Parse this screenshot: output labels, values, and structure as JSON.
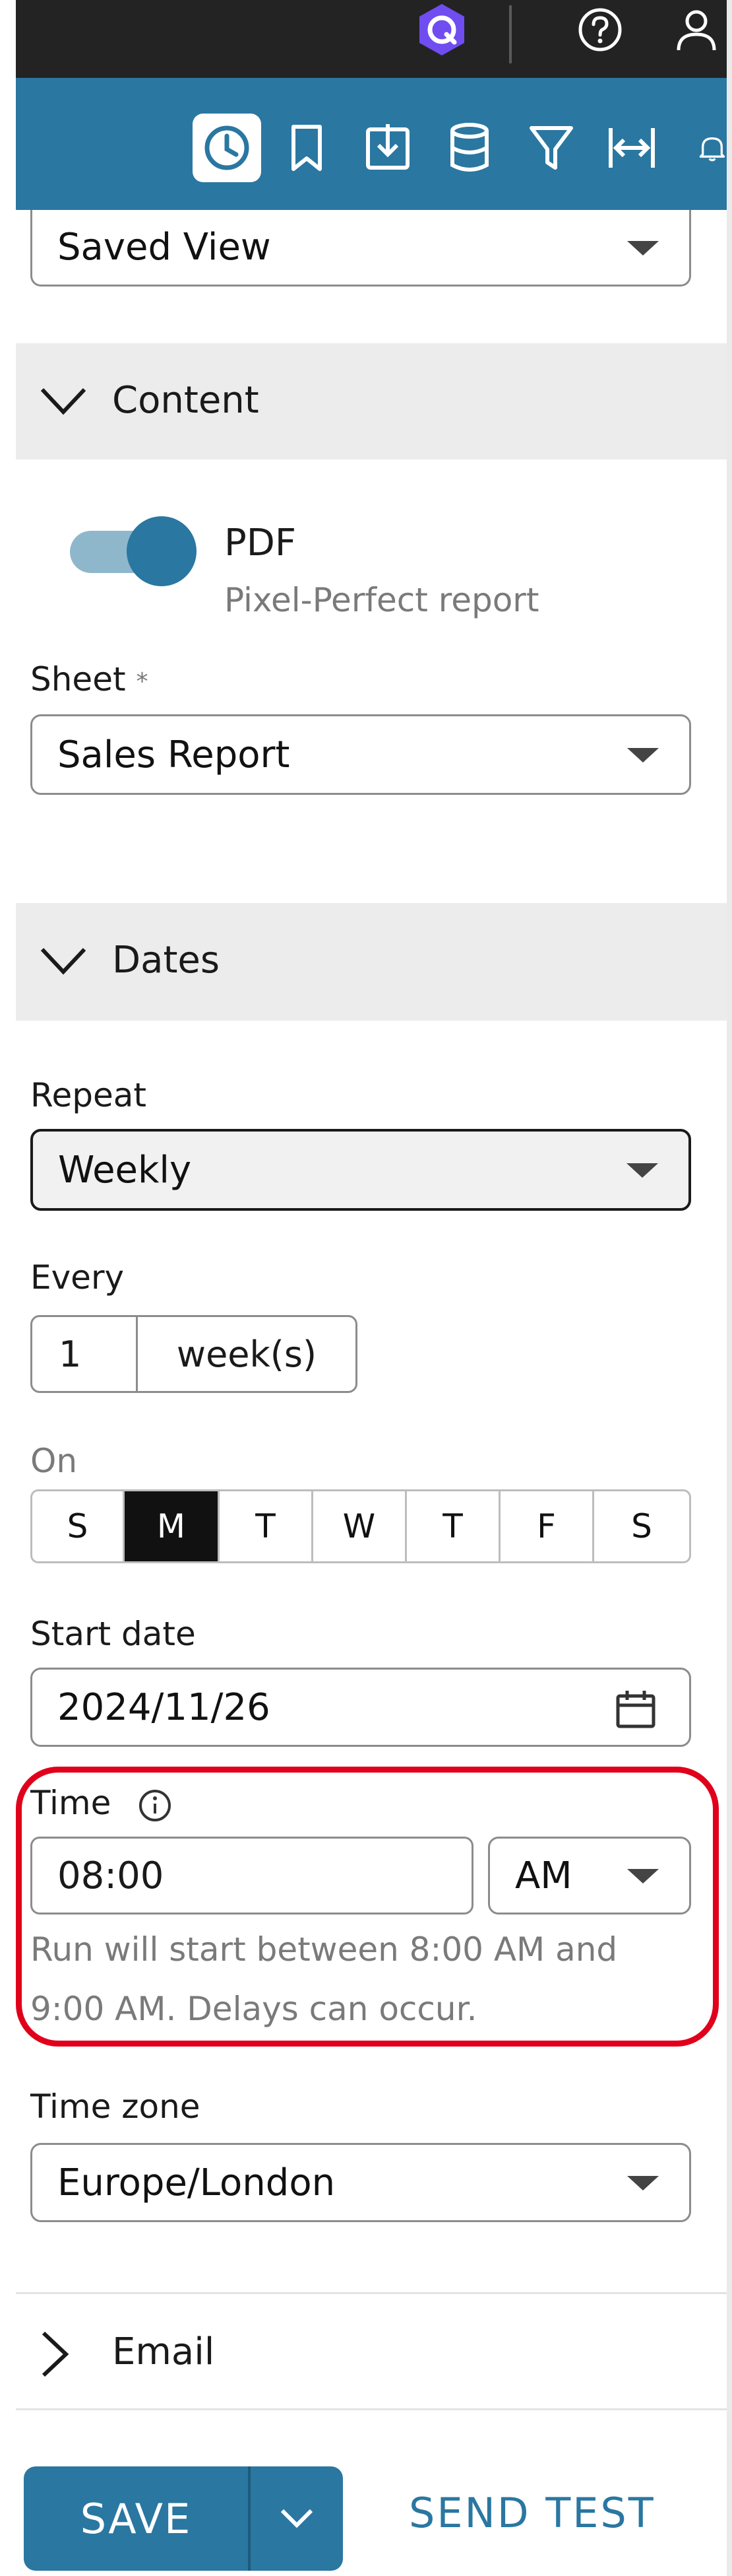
{
  "topbar": {
    "icons": [
      "app-logo-icon",
      "help-icon",
      "user-icon"
    ]
  },
  "toolbar": {
    "icons": [
      "clock-icon",
      "bookmark-icon",
      "download-icon",
      "database-icon",
      "filter-icon",
      "width-icon",
      "bell-icon"
    ]
  },
  "saved_view": {
    "value": "Saved View"
  },
  "content_section": {
    "title": "Content",
    "toggle_label": "PDF",
    "toggle_sub": "Pixel-Perfect report",
    "toggle_on": true
  },
  "sheet": {
    "label": "Sheet",
    "required_mark": "*",
    "value": "Sales Report"
  },
  "dates_section": {
    "title": "Dates"
  },
  "repeat": {
    "label": "Repeat",
    "value": "Weekly"
  },
  "every": {
    "label": "Every",
    "value": "1",
    "unit": "week(s)"
  },
  "on": {
    "label": "On",
    "days": [
      "S",
      "M",
      "T",
      "W",
      "T",
      "F",
      "S"
    ],
    "selected_index": 1
  },
  "start_date": {
    "label": "Start date",
    "value": "2024/11/26"
  },
  "time": {
    "label": "Time",
    "value": "08:00",
    "ampm": "AM",
    "hint_line1": "Run will start between 8:00 AM and",
    "hint_line2": "9:00 AM. Delays can occur."
  },
  "timezone": {
    "label": "Time zone",
    "value": "Europe/London"
  },
  "email_section": {
    "title": "Email"
  },
  "footer": {
    "save_label": "SAVE",
    "send_test_label": "SEND TEST"
  },
  "colors": {
    "brand": "#2a77a1",
    "highlight": "#e0001b",
    "topbar": "#232323"
  }
}
